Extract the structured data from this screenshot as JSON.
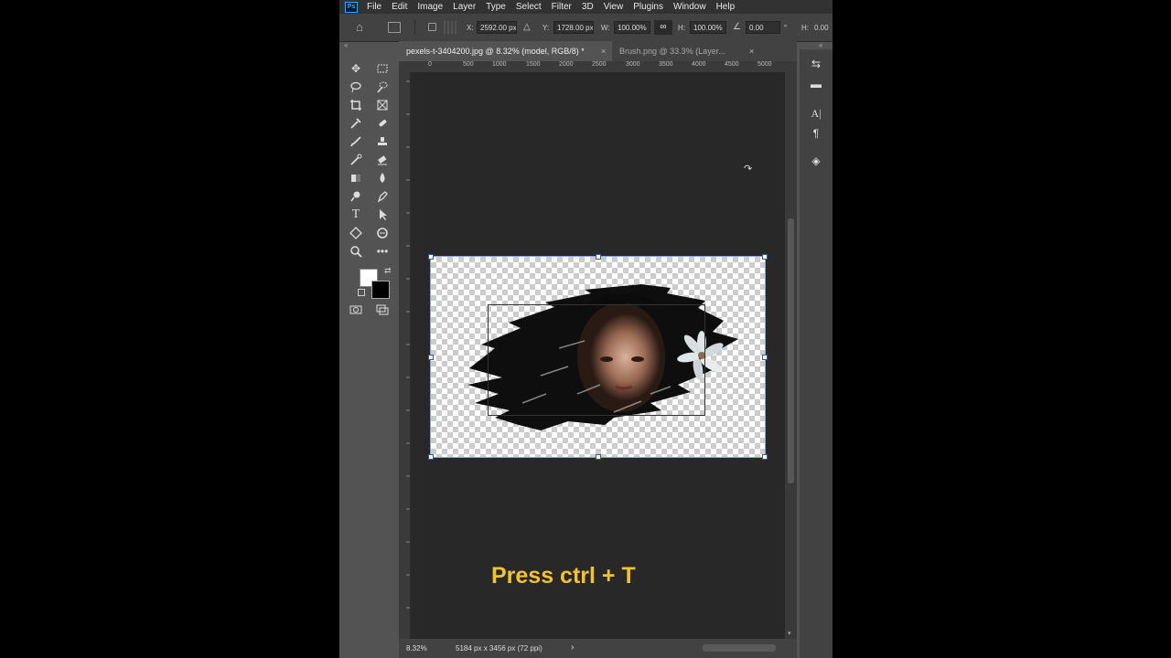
{
  "app": {
    "logo_text": "Ps"
  },
  "menu": [
    "File",
    "Edit",
    "Image",
    "Layer",
    "Type",
    "Select",
    "Filter",
    "3D",
    "View",
    "Plugins",
    "Window",
    "Help"
  ],
  "options": {
    "x_label": "X:",
    "x_value": "2592.00 px",
    "y_label": "Y:",
    "y_value": "1728.00 px",
    "w_label": "W:",
    "w_value": "100.00%",
    "h_label": "H:",
    "h_value": "100.00%",
    "angle_value": "0.00",
    "angle_unit": "°",
    "h2_label": "H:",
    "h2_value": "0.00"
  },
  "tabs": [
    {
      "label": "pexels-t-3404200.jpg @ 8.32% (model, RGB/8) *",
      "close": "×"
    },
    {
      "label": "Brush.png @ 33.3% (Layer...",
      "close": "×"
    }
  ],
  "ruler_h": [
    "0",
    "500",
    "1000",
    "1500",
    "2000",
    "2500",
    "3000",
    "3500",
    "4000",
    "4500",
    "5000"
  ],
  "canvas": {
    "caption": "Press ctrl + T"
  },
  "status": {
    "zoom": "8.32%",
    "doc_info": "5184 px x 3456 px (72 ppi)",
    "arrow": "›"
  },
  "colors": {
    "foreground": "#ffffff",
    "background": "#000000",
    "accent": "#31a8ff",
    "caption": "#f1c232"
  }
}
